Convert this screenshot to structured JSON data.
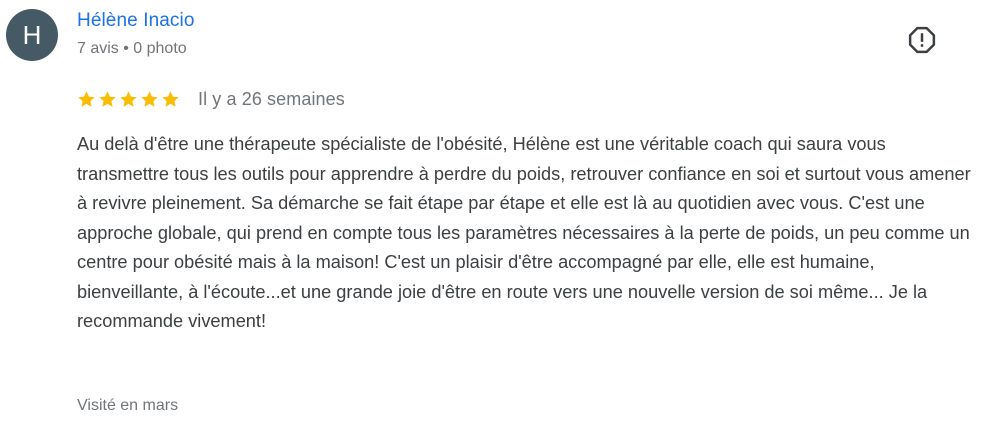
{
  "review": {
    "author": {
      "initial": "H",
      "avatar_color": "#455a64",
      "name": "Hélène Inacio",
      "meta": "7 avis • 0 photo"
    },
    "report_icon": "report-flag-icon",
    "rating": 5,
    "rating_max": 5,
    "star_color": "#fbbc04",
    "date": "Il y a 26 semaines",
    "text": "Au delà d'être une thérapeute spécialiste de l'obésité, Hélène est une véritable coach qui saura vous transmettre tous les outils pour apprendre à perdre du poids, retrouver confiance en soi et surtout vous amener à revivre pleinement. Sa démarche se fait étape par étape et elle est là au quotidien avec vous. C'est une approche globale, qui prend en compte tous les paramètres nécessaires à la perte de poids, un peu comme un centre pour obésité mais à la maison! C'est un plaisir d'être accompagné par elle, elle est humaine, bienveillante, à l'écoute...et une grande joie d'être en route vers une nouvelle version de soi même... Je la recommande vivement!",
    "visited": "Visité en mars"
  }
}
